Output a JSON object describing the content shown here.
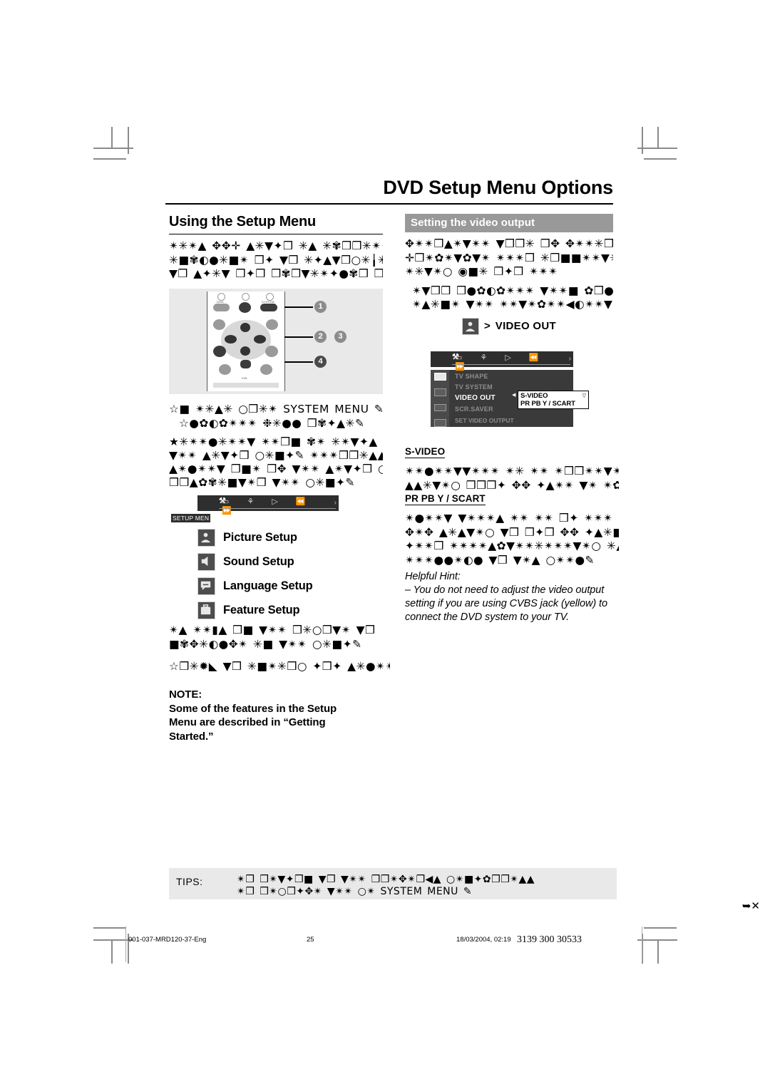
{
  "document": {
    "title": "DVD Setup Menu Options"
  },
  "left_column": {
    "section_heading": "Using the Setup Menu",
    "body_paragraph_lines": [
      "✴✳✴▲ ✥✥✛ ▲✳▼✦❒ ✳▲ ✳✾❒❒✳✴✴ ❒✦▼ ✥✳✴❒▼▲✴✳▼✴✳ ▼❒❒✳ ❒✥ ✥✳✴✳❒ ❒✦▼",
      "✳■✾◐●✳■✴ ❒✦ ▼❒ ✳✦▲▼❒○✳╽✳ ▼✴✴ ✥✾✴ ✳▼✴▲✥▼✴✴ ✥✴✴✴❒ ✳❒■■✴✴▼✴",
      "▼❒ ▲✦✳▼ ❒✦❒ ❒✾❒▼✳✴✦●✾❒ ❒✳❒✦✳❒▼✴✦✴✾✴✴✿▲▲▼✳○ ◉■✳ ❒✦❒ ✳✴✴"
    ],
    "callout_caption_lines": [
      "☆■ ✴✳▲✳ ○❒✳✴ SYSTEM MENU ✎",
      "☆●✿◐✿✴✴✴ ❉✳●● ❒✾✦▲✳✎"
    ],
    "steps_text_lines": [
      "★✳✴✴●✳✴✴▼    ✴✴❒■ ✾✴ ✳✴▼✦▲",
      "▼✴✴ ▲✳▼✦❒ ○✳■✦✎ ✴✴✴❒❒✳▲▲",
      "▲✴●✴✴▼ ❒■✴ ❒✥ ▼✴✴ ▲✴▼✦❒ ○✴■✦",
      "❒❒▲✿✾✳■▼✴❒ ▼✴✴ ○✳■✦✎"
    ],
    "osd": {
      "label": "SETUP MEN",
      "icon_bar": [
        "tools-icon",
        "screen-icon",
        "shuffle-icon",
        "play-icon",
        "rewind-icon",
        "forward-icon"
      ],
      "menu_items": [
        {
          "icon": "picture-icon",
          "label": "Picture Setup"
        },
        {
          "icon": "sound-icon",
          "label": "Sound Setup"
        },
        {
          "icon": "language-icon",
          "label": "Language Setup"
        },
        {
          "icon": "feature-icon",
          "label": "Feature Setup"
        }
      ]
    },
    "closing_text_lines": [
      "✴▲    ✴✴▮▲ ❒■ ▼✴✴ ❒✳○❒▼✴ ▼❒",
      "■✾✥✳◐●✥✴ ✳■ ▼✴✴ ○✳■✦✎",
      "☆❒✳✹◣ ▼❒ ✳■✴✳❒○ ✦❒✦ ▲✳●✴✴▼✳■✎"
    ],
    "note": {
      "heading": "NOTE:",
      "lines": [
        "Some of the features in the Setup",
        "Menu are described in “Getting",
        "Started.”"
      ]
    },
    "remote": {
      "top_labels": [
        "DISC",
        "SYSTEM"
      ],
      "bottom_label": "VOL",
      "callout_numbers": [
        "1",
        "2",
        "3",
        "4"
      ]
    }
  },
  "right_column": {
    "banner": "Setting the video output",
    "body_paragraph_lines": [
      "✥✴✴❒▲✴▼✴✴ ▼❒❒✳ ❒✥ ✥✴✴✳❒ ❒✦▼",
      "✛❒✴✿✴▼✿▼✴ ✴✴✴❒ ✳❒■■✴✴▼✳",
      "✴✳▼✴○ ◉■✳ ❒✦❒ ✴✴✴"
    ],
    "body_paragraph2_lines": [
      "✴▼❒❒ ❒●✿◐✿✴✴✴ ▼✴✴■ ✿❒●●❒❉ ▼",
      "✴▲✳■✴ ▼✴✴ ✴✴▼✴✿✴✴◀◐✴✴▼ ✛"
    ],
    "osd": {
      "header_gt": ">",
      "header_title": "VIDEO OUT",
      "icon_bar": [
        "tools-icon",
        "screen-icon",
        "shuffle-icon",
        "play-icon",
        "rewind-icon",
        "forward-icon"
      ],
      "items": [
        "TV SHAPE",
        "TV SYSTEM",
        "VIDEO OUT",
        "SCR.SAVER"
      ],
      "active_item": "VIDEO OUT",
      "footer": "SET VIDEO OUTPUT",
      "popup_options": [
        "S-VIDEO",
        "PR PB Y / SCART"
      ]
    },
    "subsections": [
      {
        "heading": "S-VIDEO",
        "lines": [
          "✴✴●✴✴▼▼✴✴✴ ✴✳ ✴✴ ✴❒❒✴✴▼✴✴ ▼✴✴ ✴✦✥",
          "▲▲✳▼✴○ ❒❒❒✦ ✥✥ ✦▲✴✴ ▼✴ ✴✿✴✳✴❒ ✥✴✴✎"
        ]
      },
      {
        "heading": "PR PB Y / SCART",
        "lines": [
          "✴●✴✴▼ ▼✴✴✴▲ ✴✴ ✴✴ ❒✦ ✴✴✴ ✴❒■■✴✴▼✴ ▼✴✴",
          "✥✴✥ ▲✳▲▼✴○ ▼❒ ❒✦❒ ✥✥ ✦▲✳■ ✴✳○❒■✴■▼",
          "✦✴✴❒ ✴✴✴✴▲✿▼✴✴✳✴✴✴▼✴○ ✳▲ ■✦❒",
          "✴✴✴●●✴◐● ▼❒ ▼✴▲ ○✴✴●✎"
        ]
      }
    ],
    "hint": {
      "heading": "Helpful Hint:",
      "lines": [
        "–  You do not need to adjust the video output",
        "setting if you are using CVBS jack (yellow) to",
        "connect the DVD system to your TV."
      ]
    }
  },
  "tips": {
    "label": "TIPS:",
    "lines": [
      "✴❒ ❒✴▼✦❒■ ▼❒ ▼✴✴ ❒❒✴✥✴❒◀▲ ○✴■✦✿❒❒✴▲▲",
      "✴❒ ❒✴○❒✦✥✴ ▼✴✴ ○✴ SYSTEM MENU ✎"
    ],
    "end_mark": "➥✕"
  },
  "footer": {
    "file": "001-037-MRD120-37-Eng",
    "page": "25",
    "date": "18/03/2004, 02:19",
    "code": "3139 300 30533"
  }
}
